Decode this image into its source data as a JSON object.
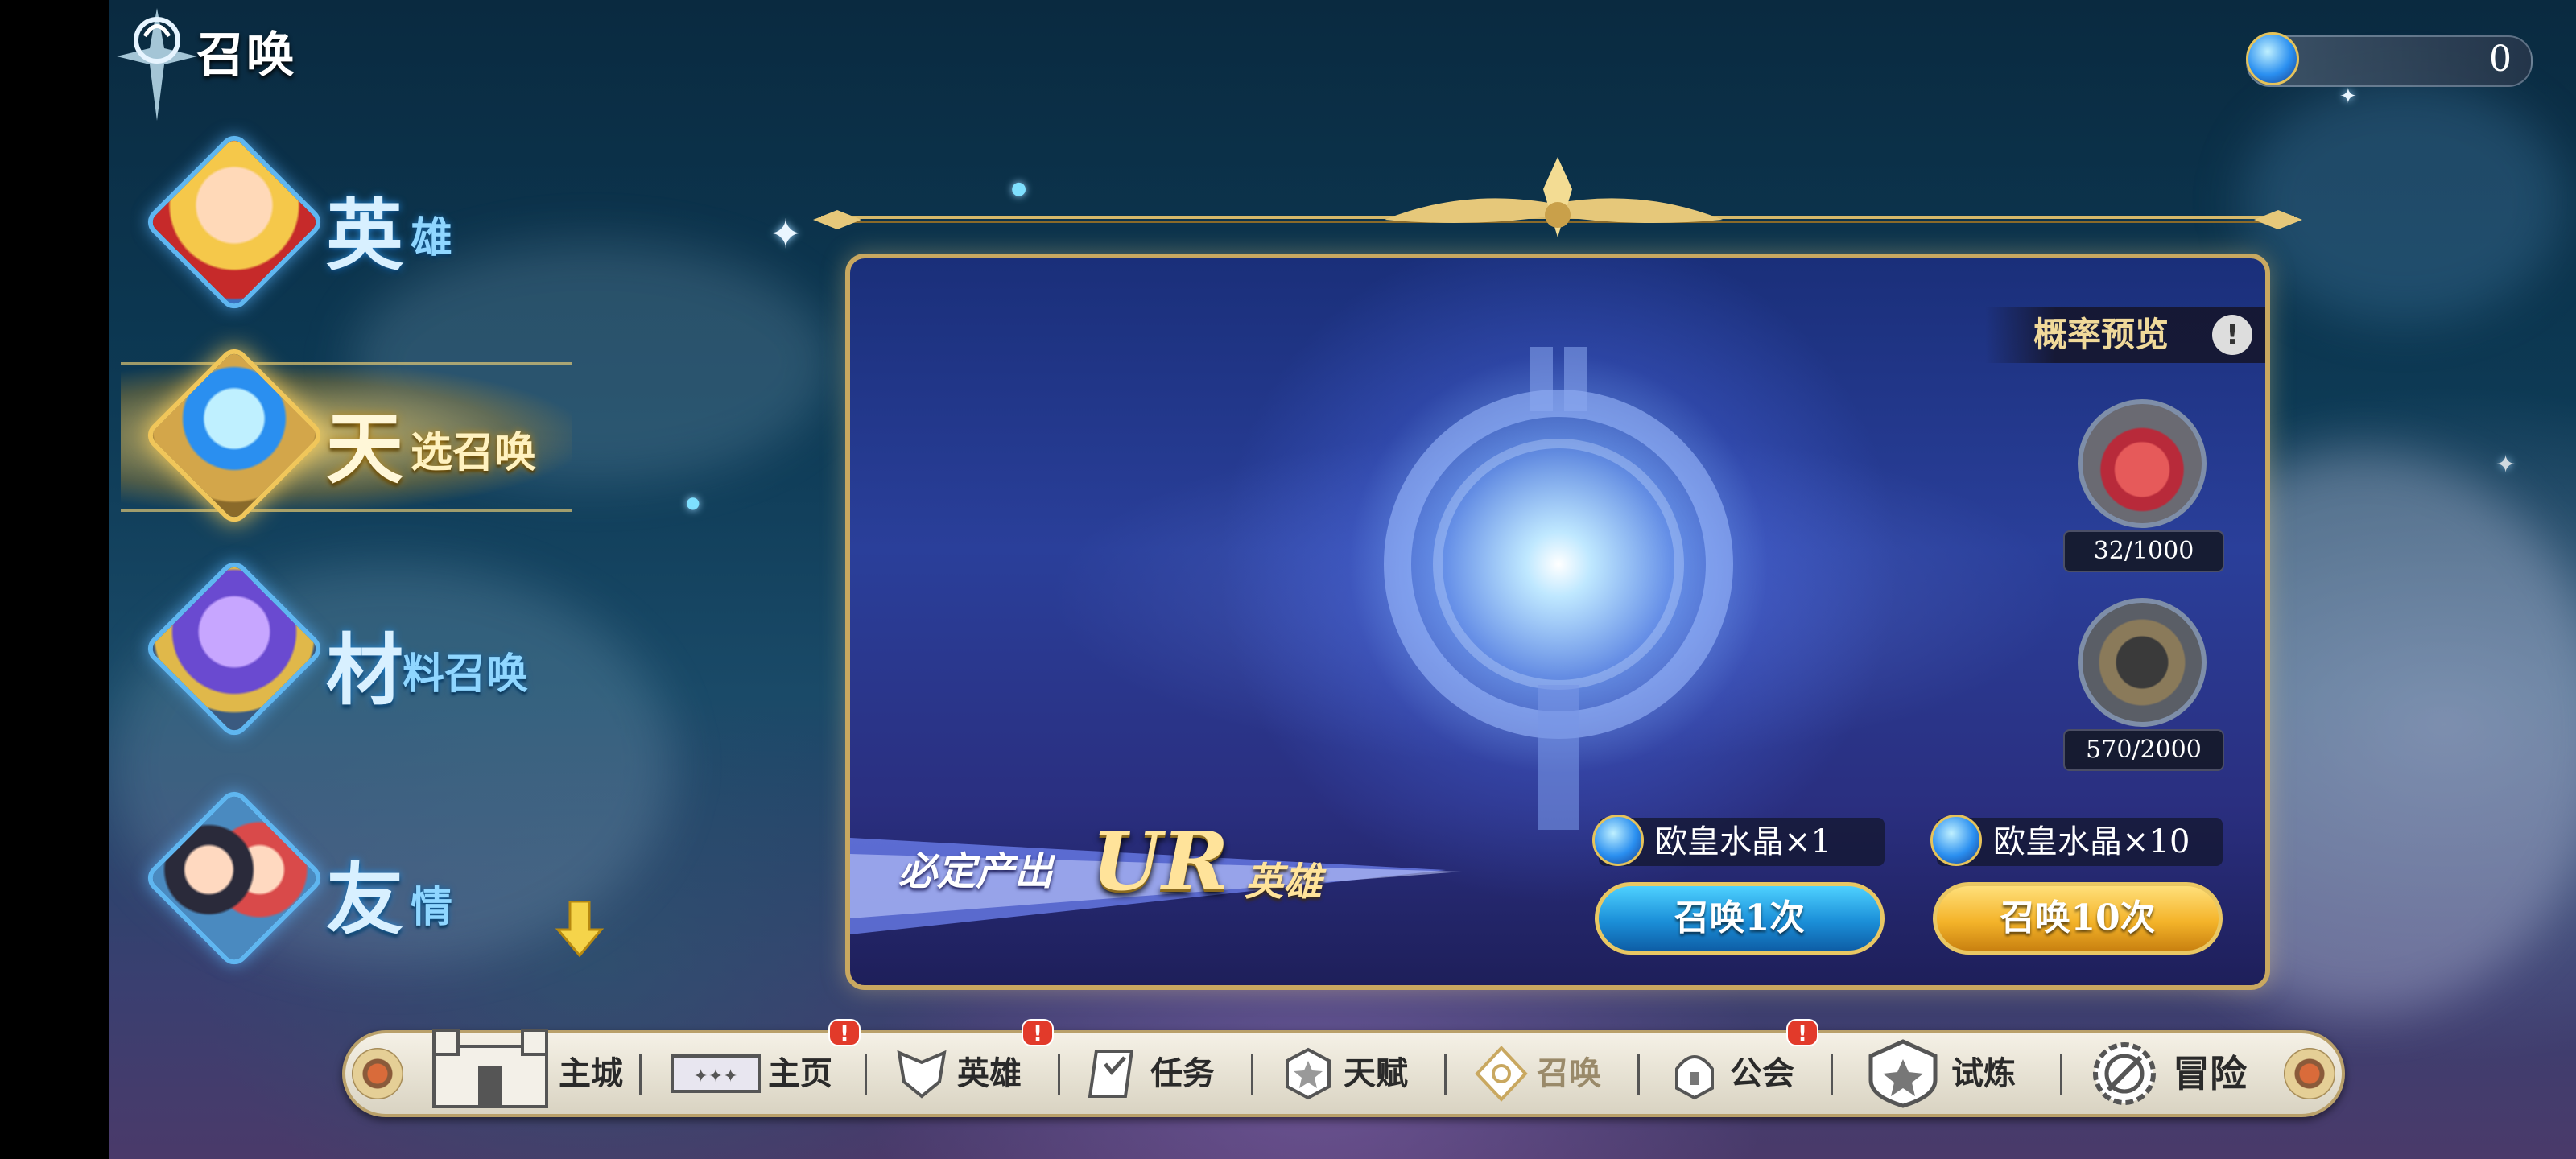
{
  "header": {
    "title": "召唤",
    "emblem_icon": "compass-star-icon"
  },
  "currency": {
    "icon": "blue-crystal-icon",
    "value": "0"
  },
  "menu": {
    "items": [
      {
        "big": "英",
        "small": "雄",
        "portrait": "hero-portrait-icon",
        "active": false
      },
      {
        "big": "天",
        "small": "选召唤",
        "portrait": "summon-orb-icon",
        "active": true
      },
      {
        "big": "材",
        "small": "料召唤",
        "portrait": "crystal-cluster-icon",
        "active": false
      },
      {
        "big": "友",
        "small": "情",
        "portrait": "friends-portrait-icon",
        "active": false
      }
    ],
    "scroll_icon": "chevron-down-icon"
  },
  "panel": {
    "rate_preview_label": "概率预览",
    "rate_preview_icon_text": "!",
    "rewards": [
      {
        "icon": "treasure-chest-icon",
        "count": "32/1000"
      },
      {
        "icon": "select-hero-icon",
        "count": "570/2000"
      }
    ],
    "banner": {
      "prefix": "必定产出",
      "highlight": "UR",
      "suffix": "英雄"
    },
    "costs": [
      {
        "icon": "blue-crystal-icon",
        "text": "欧皇水晶×1"
      },
      {
        "icon": "blue-crystal-icon",
        "text": "欧皇水晶×10"
      }
    ],
    "buttons": {
      "summon_one": "召唤1次",
      "summon_ten": "召唤10次"
    }
  },
  "bottom_nav": {
    "items": [
      {
        "label": "主城",
        "icon": "castle-icon",
        "badge": ""
      },
      {
        "label": "主页",
        "icon": "home-banner-icon",
        "badge": "!"
      },
      {
        "label": "英雄",
        "icon": "hero-mask-icon",
        "badge": "!"
      },
      {
        "label": "任务",
        "icon": "task-scroll-icon",
        "badge": ""
      },
      {
        "label": "天赋",
        "icon": "talent-star-icon",
        "badge": ""
      },
      {
        "label": "召唤",
        "icon": "summon-crest-icon",
        "badge": ""
      },
      {
        "label": "公会",
        "icon": "guild-helmet-icon",
        "badge": "!"
      },
      {
        "label": "试炼",
        "icon": "trial-emblem-icon",
        "badge": ""
      },
      {
        "label": "冒险",
        "icon": "adventure-gear-icon",
        "badge": ""
      }
    ]
  },
  "colors": {
    "gold": "#c9a860",
    "panel_blue": "#2a3f9a",
    "nav_bg": "#f5f1e6",
    "badge_red": "#e23a2a"
  }
}
